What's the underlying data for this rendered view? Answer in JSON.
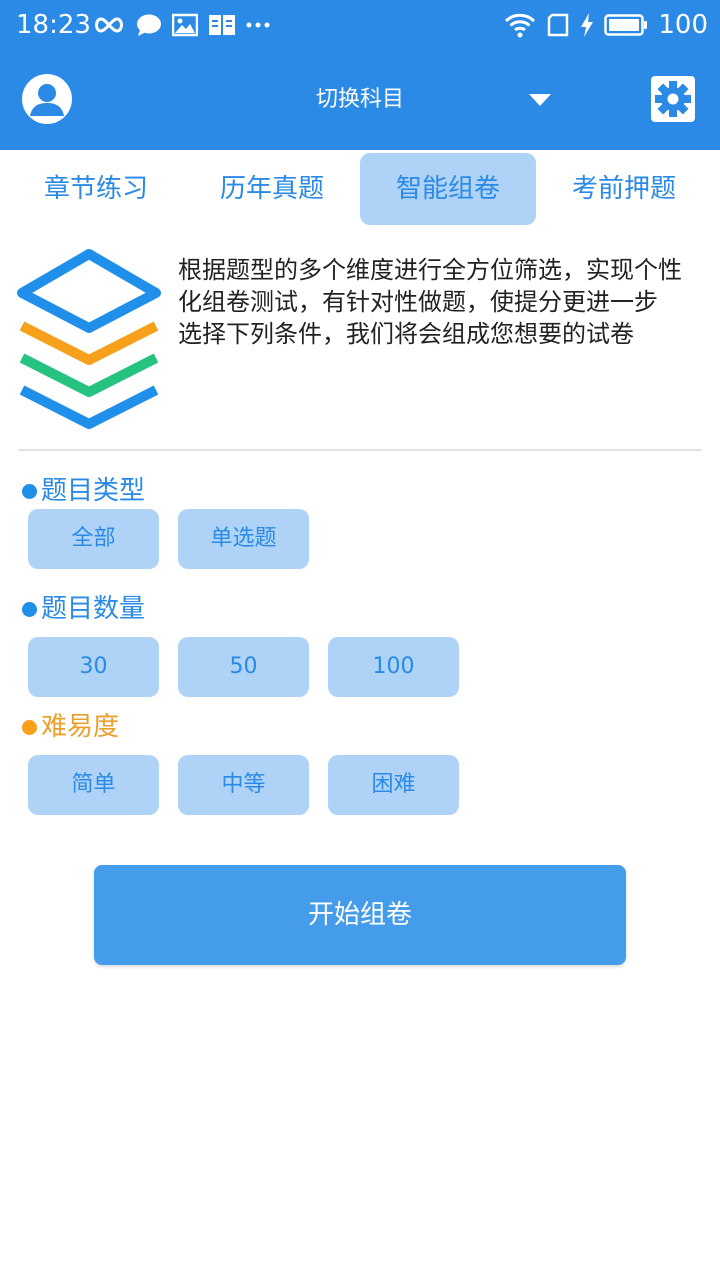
{
  "colors": {
    "primary": "#2a8ae6",
    "tab_active_bg": "#aed3f6",
    "chip_bg": "#aed3f6",
    "section_dot_blue": "#1f8fea",
    "section_dot_orange": "#f7a01c",
    "section_title_orange": "#eaa02c",
    "button_bg": "#449cea"
  },
  "status_bar": {
    "time": "18:23",
    "battery": "100",
    "left_icons": [
      "infinity-icon",
      "chat-bubble-icon",
      "image-icon",
      "book-icon",
      "more-dots-icon"
    ],
    "right_icons": [
      "wifi-icon",
      "sim-card-icon",
      "charging-bolt-icon",
      "battery-icon"
    ]
  },
  "header": {
    "avatar_icon": "user-avatar-icon",
    "subject_switch": "切换科目",
    "dropdown_icon": "caret-down-icon",
    "settings_icon": "gear-icon"
  },
  "tabs": [
    {
      "label": "章节练习",
      "active": false
    },
    {
      "label": "历年真题",
      "active": false
    },
    {
      "label": "智能组卷",
      "active": true
    },
    {
      "label": "考前押题",
      "active": false
    }
  ],
  "intro": {
    "icon": "layers-stack-icon",
    "line1": "根据题型的多个维度进行全方位筛选，实现个性化组卷测试，有针对性做题，使提分更进一步",
    "line2": "选择下列条件，我们将会组成您想要的试卷"
  },
  "filters": {
    "question_type": {
      "title": "题目类型",
      "options": [
        "全部",
        "单选题"
      ]
    },
    "question_count": {
      "title": "题目数量",
      "options": [
        "30",
        "50",
        "100"
      ]
    },
    "difficulty": {
      "title": "难易度",
      "options": [
        "简单",
        "中等",
        "困难"
      ]
    }
  },
  "start_button": "开始组卷"
}
